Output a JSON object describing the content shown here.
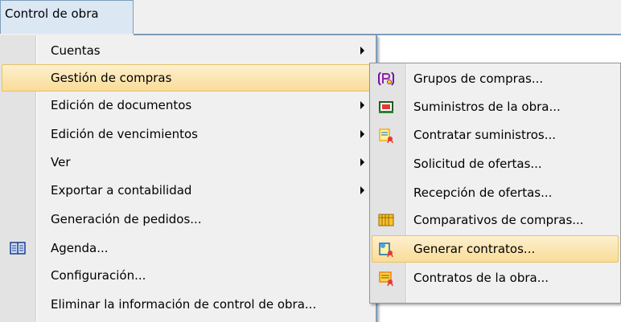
{
  "menubar": {
    "title": "Control de obra"
  },
  "main_menu": {
    "items": [
      {
        "label": "Cuentas",
        "submenu": true
      },
      {
        "label": "Gestión de compras",
        "submenu": true,
        "highlighted": true
      },
      {
        "label": "Edición de documentos",
        "submenu": true
      },
      {
        "label": "Edición de vencimientos",
        "submenu": true
      },
      {
        "label": "Ver",
        "submenu": true
      },
      {
        "label": "Exportar a contabilidad",
        "submenu": true
      },
      {
        "label": "Generación de pedidos..."
      },
      {
        "label": "Agenda...",
        "icon": "agenda-book-icon"
      },
      {
        "label": "Configuración..."
      },
      {
        "label": "Eliminar la información de control de obra..."
      }
    ]
  },
  "sub_menu": {
    "items": [
      {
        "label": "Grupos de compras...",
        "icon": "purchase-groups-icon"
      },
      {
        "label": "Suministros de la obra...",
        "icon": "site-supplies-icon"
      },
      {
        "label": "Contratar suministros...",
        "icon": "contract-supplies-icon"
      },
      {
        "label": "Solicitud de ofertas..."
      },
      {
        "label": "Recepción de ofertas..."
      },
      {
        "label": "Comparativos de compras...",
        "icon": "comparatives-grid-icon"
      },
      {
        "label": "Generar contratos...",
        "icon": "generate-contracts-icon",
        "highlighted": true
      },
      {
        "label": "Contratos de la obra...",
        "icon": "site-contracts-icon"
      }
    ]
  },
  "colors": {
    "menu_background": "#f0f0f0",
    "highlight_top": "#fdf0cf",
    "highlight_bottom": "#f9dc97",
    "highlight_border": "#e5c365",
    "menubar_active": "#dce7f4"
  }
}
